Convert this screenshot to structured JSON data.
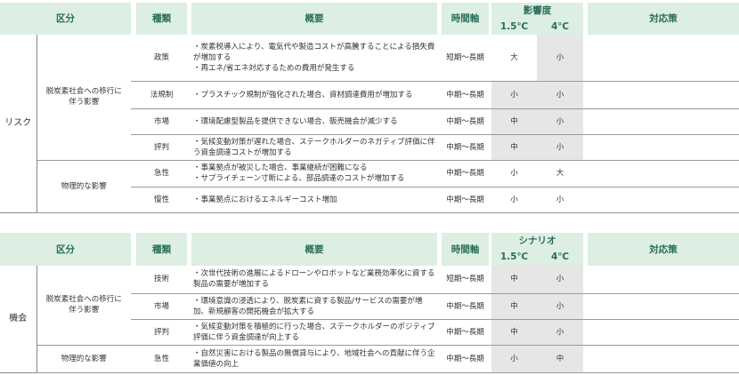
{
  "risk": {
    "headers": {
      "kubun": "区分",
      "shurui": "種類",
      "gaiyou": "概要",
      "jikan": "時間軸",
      "degree": "影響度",
      "t15": "1.5℃",
      "t4": "4℃",
      "taiou": "対応策"
    },
    "category": "リスク",
    "groups": {
      "transition": "脱炭素社会への移行に伴う影響",
      "physical": "物理的な影響"
    },
    "rows": [
      {
        "type": "政策",
        "lines": [
          "・炭素税導入により、電気代や製造コストが高騰することによる損失費が増加する",
          "・再エネ/省エネ対応するための費用が発生する"
        ],
        "time": "短期～長期",
        "v15": "大",
        "v4": "小"
      },
      {
        "type": "法規制",
        "lines": [
          "・プラスチック規制が強化された場合、資材調達費用が増加する"
        ],
        "time": "中期～長期",
        "v15": "小",
        "v4": "小"
      },
      {
        "type": "市場",
        "lines": [
          "・環境配慮型製品を提供できない場合、販売機会が減少する"
        ],
        "time": "中期～長期",
        "v15": "中",
        "v4": "小"
      },
      {
        "type": "評判",
        "lines": [
          "・気候変動対策が遅れた場合、ステークホルダーのネガティブ評価に伴う資金調達コストが増加する"
        ],
        "time": "中期～長期",
        "v15": "中",
        "v4": "小"
      },
      {
        "type": "急性",
        "lines": [
          "・事業拠点が被災した場合、事業継続が困難になる",
          "・サプライチェーン寸断による、部品調達のコストが増加する"
        ],
        "time": "中期～長期",
        "v15": "小",
        "v4": "大"
      },
      {
        "type": "慢性",
        "lines": [
          "・事業拠点におけるエネルギーコスト増加"
        ],
        "time": "中期～長期",
        "v15": "小",
        "v4": "小"
      }
    ]
  },
  "opportunity": {
    "headers": {
      "kubun": "区分",
      "shurui": "種類",
      "gaiyou": "概要",
      "jikan": "時間軸",
      "degree": "シナリオ",
      "t15": "1.5℃",
      "t4": "4℃",
      "taiou": "対応策"
    },
    "category": "機会",
    "groups": {
      "transition": "脱炭素社会への移行に伴う影響",
      "physical": "物理的な影響"
    },
    "rows": [
      {
        "type": "技術",
        "lines": [
          "・次世代技術の進展によるドローンやロボットなど業務効率化に資する製品の需要が増加する"
        ],
        "time": "短期～長期",
        "v15": "中",
        "v4": "小"
      },
      {
        "type": "市場",
        "lines": [
          "・環境意識の浸透により、脱炭素に資する製品/サービスの需要が増加、新規顧客の開拓機会が拡大する"
        ],
        "time": "中期～長期",
        "v15": "中",
        "v4": "小"
      },
      {
        "type": "評判",
        "lines": [
          "・気候変動対策を積極的に行った場合、ステークホルダーのポジティブ評価に伴う資金調達が向上する"
        ],
        "time": "中期～長期",
        "v15": "中",
        "v4": "小"
      },
      {
        "type": "急性",
        "lines": [
          "・自然災害における製品の無償貸与により、地域社会への貢献に伴う企業価値の向上"
        ],
        "time": "中期～長期",
        "v15": "小",
        "v4": "中"
      }
    ]
  },
  "colors": {
    "header_bg": "#dcefe2",
    "header_text": "#2a6d5a",
    "gray_cell": "#e6e6e6"
  }
}
